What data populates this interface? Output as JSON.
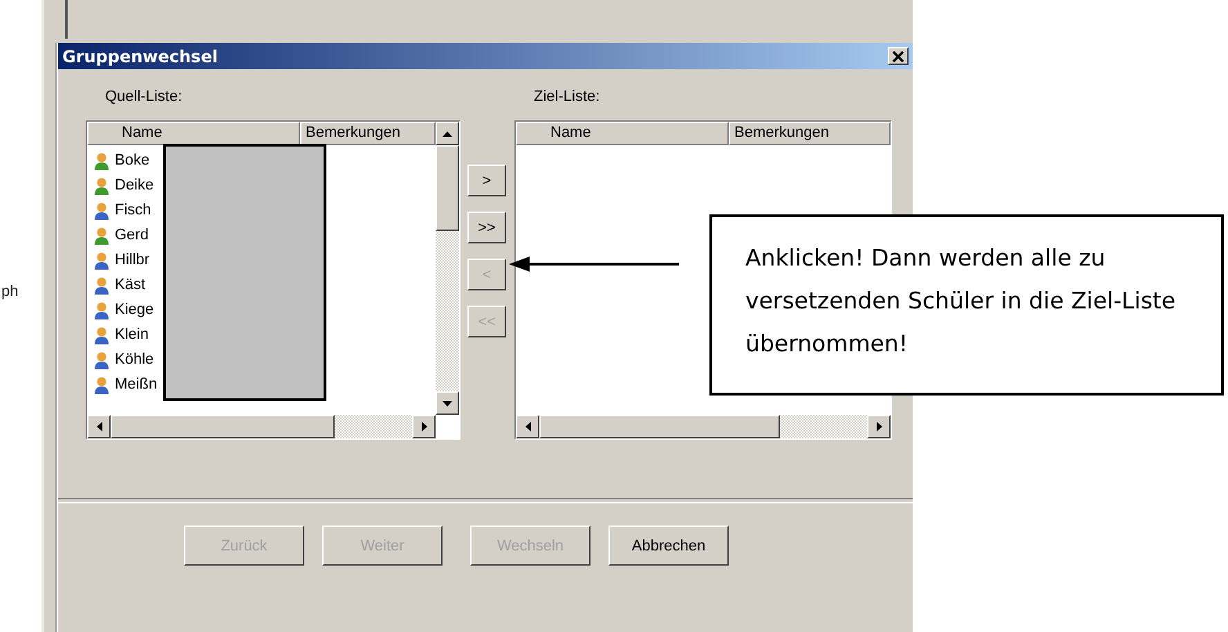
{
  "background_text": "ph",
  "window": {
    "title": "Gruppenwechsel"
  },
  "source_list": {
    "label": "Quell-Liste:",
    "columns": [
      "Name",
      "Bemerkungen"
    ],
    "rows": [
      {
        "name": "Boke",
        "color": "#3f9a2c"
      },
      {
        "name": "Deike",
        "color": "#3f9a2c"
      },
      {
        "name": "Fisch",
        "color": "#3a64c4"
      },
      {
        "name": "Gerd",
        "color": "#3f9a2c"
      },
      {
        "name": "Hillbr",
        "color": "#3a64c4"
      },
      {
        "name": "Käst",
        "color": "#3a64c4"
      },
      {
        "name": "Kiege",
        "color": "#3a64c4"
      },
      {
        "name": "Klein",
        "color": "#3a64c4"
      },
      {
        "name": "Köhle",
        "color": "#3a64c4"
      },
      {
        "name": "Meißn",
        "color": "#3a64c4"
      }
    ]
  },
  "move_buttons": [
    {
      "label": ">",
      "disabled": false
    },
    {
      "label": ">>",
      "disabled": false
    },
    {
      "label": "<",
      "disabled": true
    },
    {
      "label": "<<",
      "disabled": true
    }
  ],
  "target_list": {
    "label": "Ziel-Liste:",
    "columns": [
      "Name",
      "Bemerkungen"
    ]
  },
  "callout": {
    "text": "Anklicken! Dann werden alle zu versetzenden Schüler in die Ziel-Liste übernommen!"
  },
  "buttons": [
    {
      "label": "Zurück",
      "disabled": true
    },
    {
      "label": "Weiter",
      "disabled": true
    },
    {
      "label": "Wechseln",
      "disabled": true
    },
    {
      "label": "Abbrechen",
      "disabled": false
    }
  ]
}
